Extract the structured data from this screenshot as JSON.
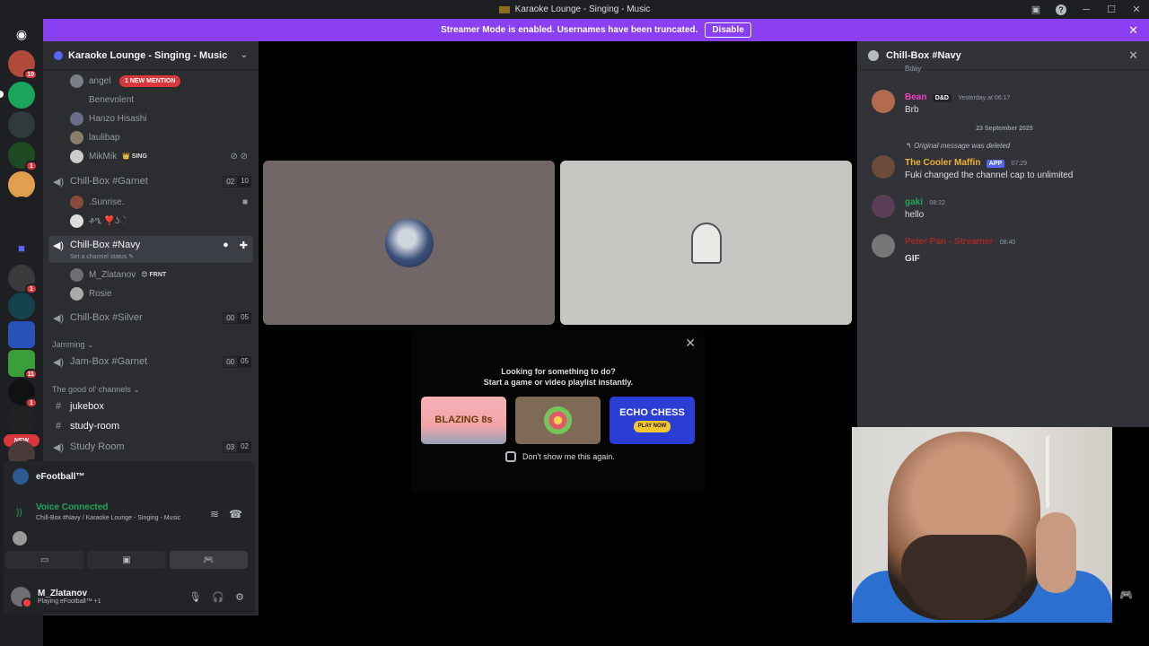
{
  "window": {
    "title": "Karaoke Lounge - Singing - Music"
  },
  "banner": {
    "text": "Streamer Mode is enabled. Usernames have been truncated.",
    "button": "Disable"
  },
  "rail": {
    "badges": [
      "10",
      "1",
      "1",
      "86",
      "11",
      "1",
      "1"
    ],
    "new_label": "NEW"
  },
  "sidebar": {
    "server_name": "Karaoke Lounge - Singing - Music",
    "mention_label": "1 NEW MENTION",
    "users_top": [
      {
        "name": "angel"
      },
      {
        "name": "Benevolent"
      },
      {
        "name": "Hanzo Hisashi"
      },
      {
        "name": "laulibap"
      },
      {
        "name": "MikMik",
        "tag": "SING"
      }
    ],
    "channel_garnet": {
      "name": "Chill-Box #Garnet",
      "count_a": "02",
      "count_b": "10"
    },
    "garnet_users": [
      {
        "name": ".Sunrise."
      },
      {
        "name": "ቶዒ ❣️ʖૅ"
      }
    ],
    "channel_navy": {
      "name": "Chill-Box #Navy",
      "status": "Set a channel status"
    },
    "navy_users": [
      {
        "name": "M_Zlatanov",
        "tag": "FRNT"
      },
      {
        "name": "Rosie"
      }
    ],
    "channel_silver": {
      "name": "Chill-Box #Silver",
      "count_a": "00",
      "count_b": "05"
    },
    "category_jamming": "Jamming",
    "channel_jam": {
      "name": "Jam-Box #Garnet",
      "count_a": "00",
      "count_b": "05"
    },
    "category_good": "The good ol' channels",
    "text_channels": [
      {
        "name": "jukebox"
      },
      {
        "name": "study-room"
      }
    ],
    "channel_study": {
      "name": "Study Room",
      "count_a": "03",
      "count_b": "02"
    }
  },
  "voice": {
    "activity": "eFootball™",
    "status": "Voice Connected",
    "location": "Chill-Box #Navy / Karaoke Lounge - Singing - Music"
  },
  "user_panel": {
    "name": "M_Zlatanov",
    "status": "Playing eFootball™ +1"
  },
  "modal": {
    "title_line1": "Looking for something to do?",
    "title_line2": "Start a game or video playlist instantly.",
    "cards": [
      {
        "label": "BLAZING 8s"
      },
      {
        "label": ""
      },
      {
        "label": "ECHO CHESS",
        "cta": "PLAY NOW"
      }
    ],
    "dont_show": "Don't show me this again."
  },
  "chat": {
    "header": "Chill-Box #Navy",
    "top_fragment": "Bday",
    "date_divider": "23 September 2025",
    "reply_note": "Original message was deleted",
    "messages": [
      {
        "author": "Bean",
        "author_color": "#f23fc5",
        "tag": "D&D",
        "time": "Yesterday at 06:17",
        "text": "Brb"
      },
      {
        "author": "The Cooler Maffin",
        "author_color": "#f0b232",
        "chip": "APP",
        "time": "07:29",
        "text": "Fuki changed the channel cap to unlimited"
      },
      {
        "author": "gaki",
        "author_color": "#23a55a",
        "time": "08:22",
        "text": "hello"
      },
      {
        "author": "Peter Pan - Streamer",
        "author_color": "#a12828",
        "time": "08:40",
        "text": "GIF"
      }
    ]
  }
}
